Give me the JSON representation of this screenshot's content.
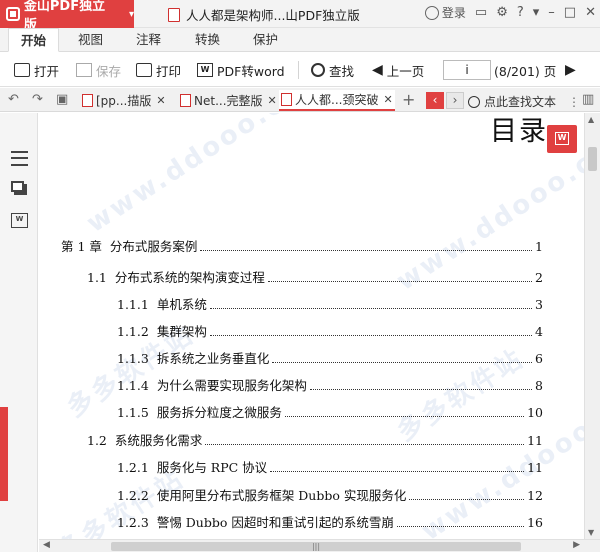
{
  "app": {
    "menu_button_label": "金山PDF独立版",
    "document_title": "人人都是架构师...山PDF独立版",
    "login_label": "登录"
  },
  "menu_tabs": [
    "开始",
    "视图",
    "注释",
    "转换",
    "保护"
  ],
  "toolbar": {
    "open_label": "打开",
    "save_label": "保存",
    "print_label": "打印",
    "pdf_to_word_label": "PDF转word",
    "find_label": "查找",
    "prev_page_label": "上一页",
    "page_input_value": "i",
    "page_count": "(8/201) 页"
  },
  "doc_tabs": [
    {
      "label": "[pp...描版"
    },
    {
      "label": "Net...完整版"
    },
    {
      "label": "人人都...颈突破"
    }
  ],
  "find_text_label": "点此查找文本",
  "page": {
    "heading": "目录",
    "toc": [
      {
        "num": "第 1 章",
        "title": "分布式服务案例",
        "page": "1"
      },
      {
        "num": "1.1",
        "title": "分布式系统的架构演变过程",
        "page": "2"
      },
      {
        "num": "1.1.1",
        "title": "单机系统",
        "page": "3"
      },
      {
        "num": "1.1.2",
        "title": "集群架构",
        "page": "4"
      },
      {
        "num": "1.1.3",
        "title": "拆系统之业务垂直化",
        "page": "6"
      },
      {
        "num": "1.1.4",
        "title": "为什么需要实现服务化架构",
        "page": "8"
      },
      {
        "num": "1.1.5",
        "title": "服务拆分粒度之微服务",
        "page": "10"
      },
      {
        "num": "1.2",
        "title": "系统服务化需求",
        "page": "11"
      },
      {
        "num": "1.2.1",
        "title": "服务化与 RPC 协议",
        "page": "11"
      },
      {
        "num": "1.2.2",
        "title": "使用阿里分布式服务框架 Dubbo 实现服务化",
        "page": "12"
      },
      {
        "num": "1.2.3",
        "title": "警惕 Dubbo 因超时和重试引起的系统雪崩",
        "page": "16"
      }
    ],
    "watermark_text": "www.ddooo.com",
    "watermark_text_cn": "多多软件站"
  },
  "colors": {
    "accent": "#e04040"
  }
}
